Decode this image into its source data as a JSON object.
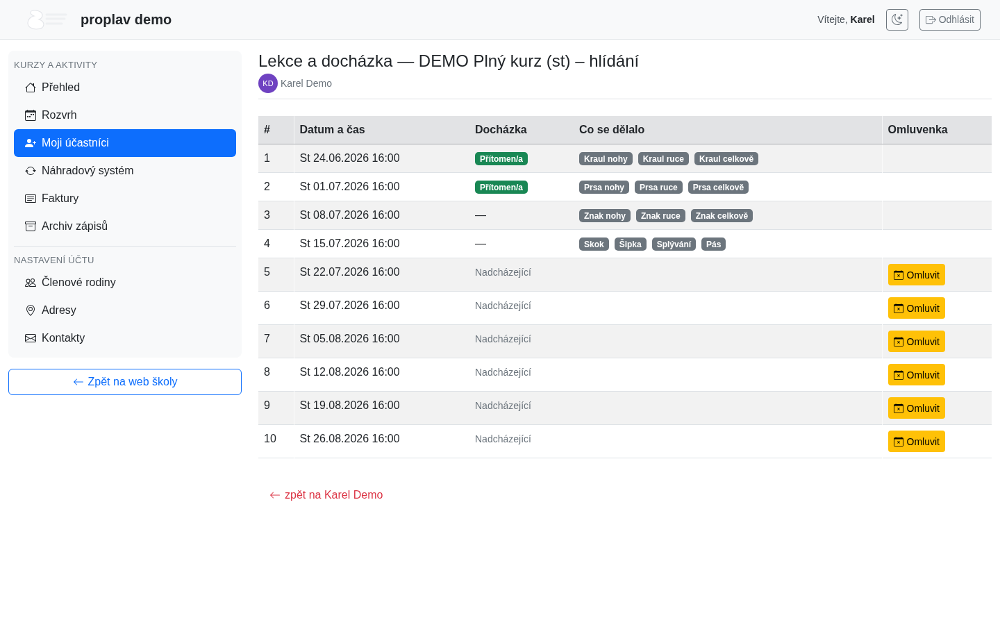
{
  "header": {
    "brand": "proplav demo",
    "greeting": "Vítejte, **Karel**",
    "logout_button": "Odhlásit"
  },
  "sidebar": {
    "sections": [
      {
        "heading": "KURZY A AKTIVITY",
        "items": [
          {
            "label": "Přehled",
            "selected": false
          },
          {
            "label": "Rozvrh",
            "selected": false
          },
          {
            "label": "Moji účastníci",
            "selected": true
          },
          {
            "label": "Náhradový systém",
            "selected": false
          },
          {
            "label": "Faktury",
            "selected": false
          },
          {
            "label": "Archiv zápisů",
            "selected": false
          }
        ]
      },
      {
        "heading": "NASTAVENÍ ÚČTU",
        "items": [
          {
            "label": "Členové rodiny",
            "selected": false
          },
          {
            "label": "Adresy",
            "selected": false
          },
          {
            "label": "Kontakty",
            "selected": false
          }
        ]
      }
    ],
    "back_button": "Zpět na web školy"
  },
  "page": {
    "title": "Lekce a docházka — DEMO Plný kurz (st) – hlídání",
    "participant": {
      "initials": "KD",
      "name": "Karel Demo"
    }
  },
  "table": {
    "columns": [
      "#",
      "Datum a čas",
      "Docházka",
      "Co se dělalo",
      "Omluvenka"
    ],
    "rows": [
      {
        "number": "1",
        "datetime": "St 24.06.2026 16:00",
        "attendance": {
          "kind": "present",
          "text": "Přítomen/a"
        },
        "activities": [
          "Kraul nohy",
          "Kraul ruce",
          "Kraul celkově"
        ]
      },
      {
        "number": "2",
        "datetime": "St 01.07.2026 16:00",
        "attendance": {
          "kind": "present",
          "text": "Přítomen/a"
        },
        "activities": [
          "Prsa nohy",
          "Prsa ruce",
          "Prsa celkově"
        ]
      },
      {
        "number": "3",
        "datetime": "St 08.07.2026 16:00",
        "attendance": {
          "kind": "unknown",
          "text": "—"
        },
        "activities": [
          "Znak nohy",
          "Znak ruce",
          "Znak celkově"
        ]
      },
      {
        "number": "4",
        "datetime": "St 15.07.2026 16:00",
        "attendance": {
          "kind": "unknown",
          "text": "—"
        },
        "activities": [
          "Skok",
          "Šipka",
          "Splývání",
          "Pás"
        ]
      },
      {
        "number": "5",
        "datetime": "St 22.07.2026 16:00",
        "attendance": {
          "kind": "upcoming",
          "text": "Nadcházející"
        },
        "excuse_button": "Omluvit"
      },
      {
        "number": "6",
        "datetime": "St 29.07.2026 16:00",
        "attendance": {
          "kind": "upcoming",
          "text": "Nadcházející"
        },
        "excuse_button": "Omluvit"
      },
      {
        "number": "7",
        "datetime": "St 05.08.2026 16:00",
        "attendance": {
          "kind": "upcoming",
          "text": "Nadcházející"
        },
        "excuse_button": "Omluvit"
      },
      {
        "number": "8",
        "datetime": "St 12.08.2026 16:00",
        "attendance": {
          "kind": "upcoming",
          "text": "Nadcházející"
        },
        "excuse_button": "Omluvit"
      },
      {
        "number": "9",
        "datetime": "St 19.08.2026 16:00",
        "attendance": {
          "kind": "upcoming",
          "text": "Nadcházející"
        },
        "excuse_button": "Omluvit"
      },
      {
        "number": "10",
        "datetime": "St 26.08.2026 16:00",
        "attendance": {
          "kind": "upcoming",
          "text": "Nadcházející"
        },
        "excuse_button": "Omluvit"
      }
    ]
  },
  "back_link": "zpět na Karel Demo"
}
